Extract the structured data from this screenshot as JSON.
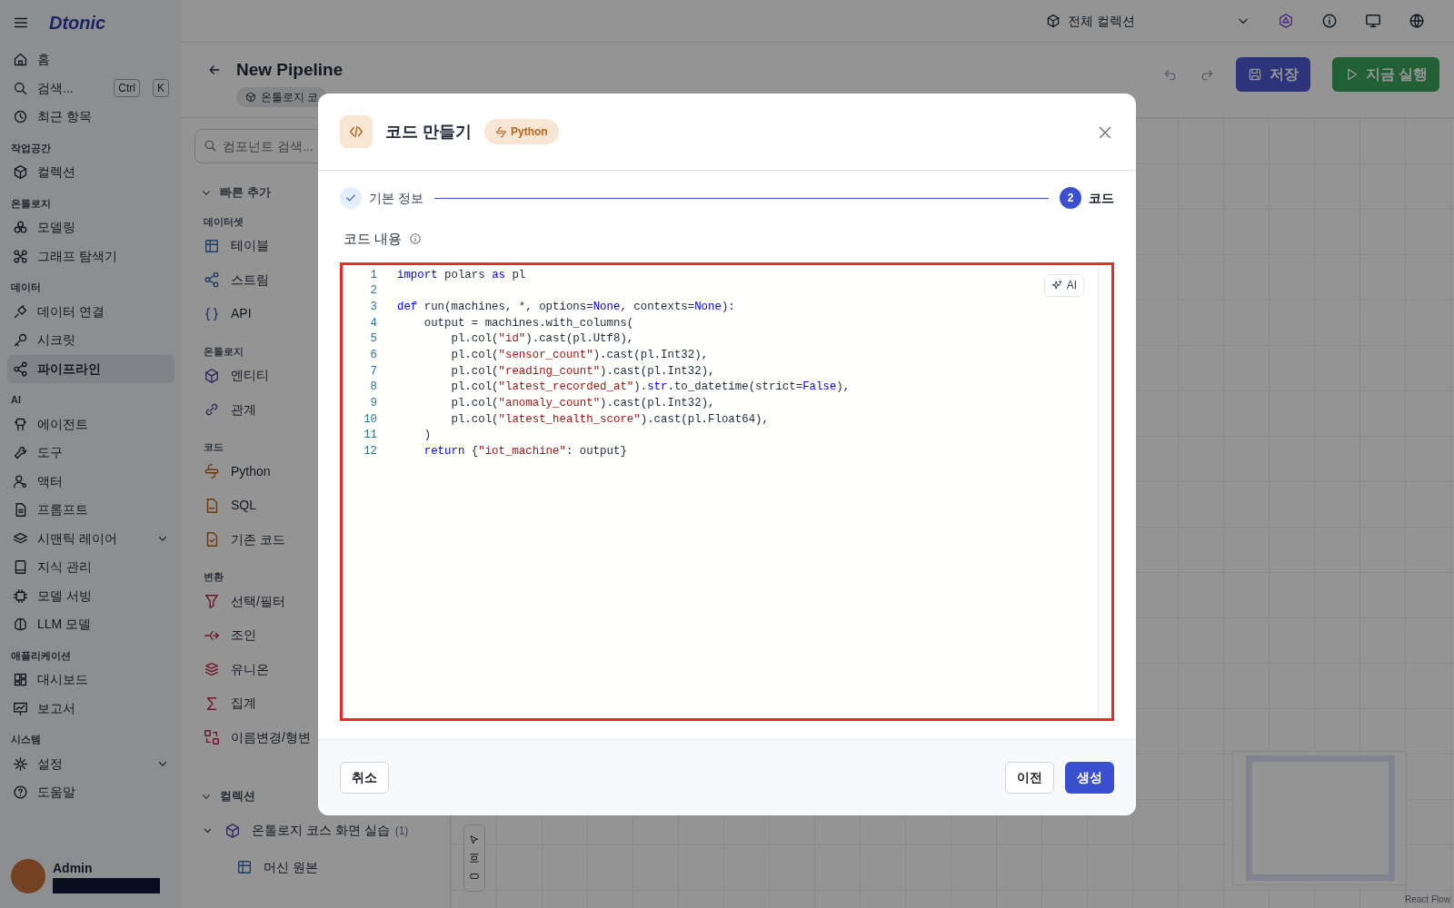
{
  "app": {
    "logo": "Dtonic",
    "collection_selector": "전체 컬렉션"
  },
  "sidebar": {
    "top_items": [
      {
        "label": "홈",
        "selected": false,
        "kind": "link"
      },
      {
        "label": "검색...",
        "selected": false,
        "kind": "search",
        "shortcut": [
          "Ctrl",
          "K"
        ]
      },
      {
        "label": "최근 항목",
        "selected": false,
        "kind": "link"
      }
    ],
    "sections": [
      {
        "title": "작업공간",
        "items": [
          {
            "label": "컬렉션",
            "selected": false,
            "kind": "link"
          }
        ]
      },
      {
        "title": "온톨로지",
        "items": [
          {
            "label": "모델링",
            "selected": false,
            "kind": "link"
          },
          {
            "label": "그래프 탐색기",
            "selected": false,
            "kind": "link"
          }
        ]
      },
      {
        "title": "데이터",
        "items": [
          {
            "label": "데이터 연결",
            "selected": false,
            "kind": "link"
          },
          {
            "label": "시크릿",
            "selected": false,
            "kind": "link"
          },
          {
            "label": "파이프라인",
            "selected": true,
            "kind": "link"
          }
        ]
      },
      {
        "title": "AI",
        "items": [
          {
            "label": "에이전트",
            "selected": false,
            "kind": "link"
          },
          {
            "label": "도구",
            "selected": false,
            "kind": "link"
          },
          {
            "label": "액터",
            "selected": false,
            "kind": "link"
          },
          {
            "label": "프롬프트",
            "selected": false,
            "kind": "link"
          },
          {
            "label": "시맨틱 레이어",
            "selected": false,
            "kind": "group"
          },
          {
            "label": "지식 관리",
            "selected": false,
            "kind": "link"
          },
          {
            "label": "모델 서빙",
            "selected": false,
            "kind": "link"
          },
          {
            "label": "LLM 모델",
            "selected": false,
            "kind": "link"
          }
        ]
      },
      {
        "title": "애플리케이션",
        "items": [
          {
            "label": "대시보드",
            "selected": false,
            "kind": "link"
          },
          {
            "label": "보고서",
            "selected": false,
            "kind": "link"
          }
        ]
      },
      {
        "title": "시스템",
        "items": [
          {
            "label": "설정",
            "selected": false,
            "kind": "group"
          },
          {
            "label": "도움말",
            "selected": false,
            "kind": "link"
          }
        ]
      }
    ],
    "user": {
      "name": "Admin"
    }
  },
  "pipeline": {
    "title": "New Pipeline",
    "chips": [
      "온톨로지 코"
    ],
    "save": "저장",
    "run": "지금 실행"
  },
  "components": {
    "search": {
      "placeholder": "컴포넌트 검색..."
    },
    "quick_add": "빠른 추가",
    "groups": [
      {
        "title": "데이터셋",
        "items": [
          "테이블",
          "스트림",
          "API"
        ]
      },
      {
        "title": "온톨로지",
        "items": [
          "엔티티",
          "관계"
        ]
      },
      {
        "title": "코드",
        "items": [
          "Python",
          "SQL",
          "기존 코드"
        ]
      },
      {
        "title": "변환",
        "items": [
          "선택/필터",
          "조인",
          "유니온",
          "집계",
          "이름변경/형변"
        ]
      }
    ],
    "collections": {
      "title": "컬렉션",
      "tree": [
        {
          "label": "온톨로지 코스 화면 실습",
          "count": "(1)",
          "expanded": true,
          "children": [
            {
              "label": "머신 원본"
            }
          ]
        }
      ]
    }
  },
  "canvas": {
    "attribution": "React Flow"
  },
  "modal": {
    "title": "코드 만들기",
    "badge": "Python",
    "steps": [
      {
        "label": "기본 정보",
        "done": true,
        "selected": false
      },
      {
        "label": "코드",
        "number": "2",
        "done": false,
        "selected": true
      }
    ],
    "field_label": "코드 내용",
    "ai_button": "AI",
    "code": [
      {
        "number": "1",
        "text": "import polars as pl"
      },
      {
        "number": "2"
      },
      {
        "number": "3",
        "text": "def run(machines, *, options=None, contexts=None):"
      },
      {
        "number": "4",
        "text": "    output = machines.with_columns("
      },
      {
        "number": "5",
        "text": "        pl.col(\"id\").cast(pl.Utf8),"
      },
      {
        "number": "6",
        "text": "        pl.col(\"sensor_count\").cast(pl.Int32),"
      },
      {
        "number": "7",
        "text": "        pl.col(\"reading_count\").cast(pl.Int32),"
      },
      {
        "number": "8",
        "text": "        pl.col(\"latest_recorded_at\").str.to_datetime(strict=False),"
      },
      {
        "number": "9",
        "text": "        pl.col(\"anomaly_count\").cast(pl.Int32),"
      },
      {
        "number": "10",
        "text": "        pl.col(\"latest_health_score\").cast(pl.Float64),"
      },
      {
        "number": "11",
        "text": "    )"
      },
      {
        "number": "12",
        "text": "    return {\"iot_machine\": output}"
      }
    ],
    "buttons": {
      "cancel": "취소",
      "previous": "이전",
      "create": "생성"
    }
  }
}
